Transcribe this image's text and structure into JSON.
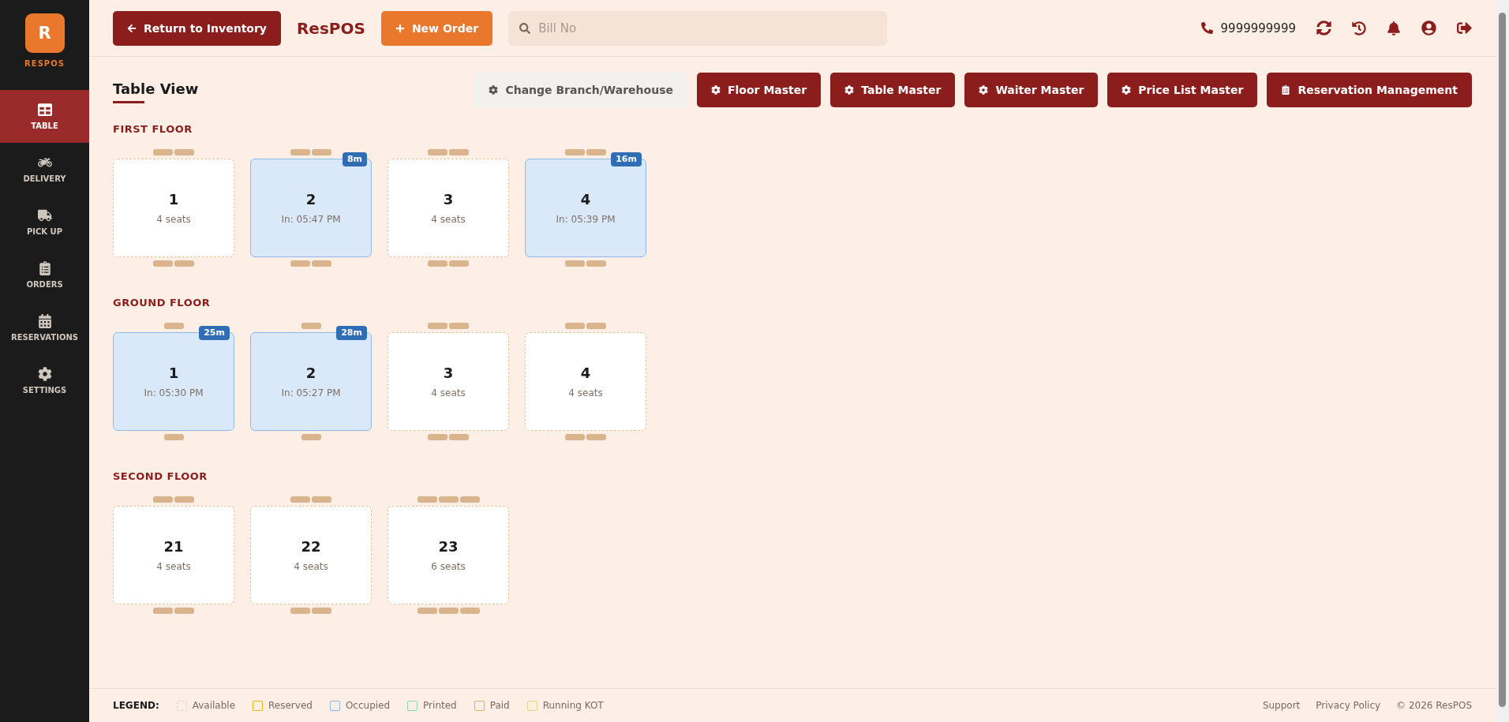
{
  "brand": {
    "mark": "R",
    "name": "RESPOS"
  },
  "sidebar": {
    "items": [
      {
        "label": "TABLE",
        "selected": true
      },
      {
        "label": "DELIVERY",
        "selected": false
      },
      {
        "label": "PICK UP",
        "selected": false
      },
      {
        "label": "ORDERS",
        "selected": false
      },
      {
        "label": "RESERVATIONS",
        "selected": false
      },
      {
        "label": "SETTINGS",
        "selected": false
      }
    ]
  },
  "topbar": {
    "back_button": "Return to Inventory",
    "logo": "ResPOS",
    "new_order_button": "New Order",
    "search": {
      "placeholder": "Bill No"
    },
    "phone": "9999999999"
  },
  "page_title": "Table View",
  "actions": [
    {
      "label": "Change Branch/Warehouse",
      "kind": "light"
    },
    {
      "label": "Floor Master",
      "kind": "dark"
    },
    {
      "label": "Table Master",
      "kind": "dark"
    },
    {
      "label": "Waiter Master",
      "kind": "dark"
    },
    {
      "label": "Price List Master",
      "kind": "dark"
    },
    {
      "label": "Reservation Management",
      "kind": "dark"
    }
  ],
  "floors": [
    {
      "name": "FIRST FLOOR",
      "tables": [
        {
          "number": "1",
          "info": "4 seats",
          "occupied": false,
          "kind": "pair"
        },
        {
          "number": "2",
          "info": "In: 05:47 PM",
          "occupied": true,
          "badge": "8m",
          "kind": "pair"
        },
        {
          "number": "3",
          "info": "4 seats",
          "occupied": false,
          "kind": "pair"
        },
        {
          "number": "4",
          "info": "In: 05:39 PM",
          "occupied": true,
          "badge": "16m",
          "kind": "pair"
        }
      ]
    },
    {
      "name": "GROUND FLOOR",
      "tables": [
        {
          "number": "1",
          "info": "In: 05:30 PM",
          "occupied": true,
          "badge": "25m",
          "kind": "single"
        },
        {
          "number": "2",
          "info": "In: 05:27 PM",
          "occupied": true,
          "badge": "28m",
          "kind": "single"
        },
        {
          "number": "3",
          "info": "4 seats",
          "occupied": false,
          "kind": "pair"
        },
        {
          "number": "4",
          "info": "4 seats",
          "occupied": false,
          "kind": "pair"
        }
      ]
    },
    {
      "name": "SECOND FLOOR",
      "tables": [
        {
          "number": "21",
          "info": "4 seats",
          "occupied": false,
          "kind": "pair"
        },
        {
          "number": "22",
          "info": "4 seats",
          "occupied": false,
          "kind": "pair"
        },
        {
          "number": "23",
          "info": "6 seats",
          "occupied": false,
          "kind": "triple"
        }
      ]
    }
  ],
  "legend": {
    "title": "LEGEND:",
    "items": [
      {
        "label": "Available",
        "kind": "dashed",
        "color": "#d8cfc6"
      },
      {
        "label": "Reserved",
        "kind": "solid",
        "color": "#f0b400"
      },
      {
        "label": "Occupied",
        "kind": "solid",
        "color": "#8fb8ea"
      },
      {
        "label": "Printed",
        "kind": "solid",
        "color": "#8fd9a8"
      },
      {
        "label": "Paid",
        "kind": "solid",
        "color": "#e6b060"
      },
      {
        "label": "Running KOT",
        "kind": "solid",
        "color": "#f0d27a"
      }
    ]
  },
  "footer_links": [
    "Support",
    "Privacy Policy",
    "© 2026 ResPOS"
  ]
}
